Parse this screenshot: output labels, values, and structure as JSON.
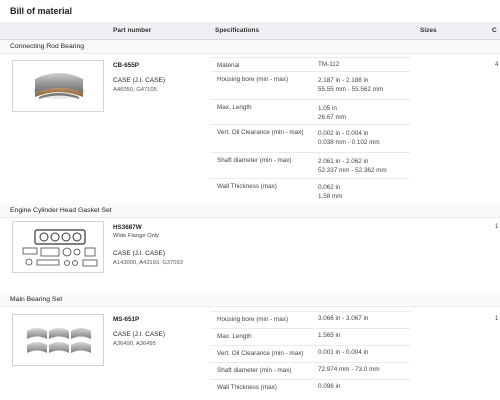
{
  "page_title": "Bill of material",
  "header": {
    "part_number": "Part number",
    "specifications": "Specifications",
    "sizes": "Sizes",
    "c": "C"
  },
  "sections": [
    {
      "title": "Connecting Rod Bearing",
      "part_number": "CB-655P",
      "subtitle": "",
      "brand": "CASE (J.I. CASE)",
      "xref": "A46050, G47105",
      "edge": "4",
      "specs": [
        {
          "label": "Material",
          "value1": "TM-112",
          "value2": ""
        },
        {
          "label": "Housing bore (min - max)",
          "value1": "2.187 in - 2.188 in",
          "value2": "55.55 mm - 55.562 mm"
        },
        {
          "label": "Max. Length",
          "value1": "1.05 in",
          "value2": "26.67 mm"
        },
        {
          "label": "Vert. Oil Clearance (min - max)",
          "value1": "0.002 in - 0.004 in",
          "value2": "0.038 mm - 0.102 mm"
        },
        {
          "label": "Shaft diameter (min - max)",
          "value1": "2.061 in - 2.062 in",
          "value2": "52.337 mm - 52.362 mm"
        },
        {
          "label": "Wall Thickness (max)",
          "value1": "0.062 in",
          "value2": "1.58 mm"
        }
      ]
    },
    {
      "title": "Engine Cylinder Head Gasket Set",
      "part_number": "HS3687W",
      "subtitle": "Wide Flange Only",
      "brand": "CASE (J.I. CASE)",
      "xref": "A143000, A43193, G37093",
      "edge": "1",
      "specs": []
    },
    {
      "title": "Main Bearing Set",
      "part_number": "MS-651P",
      "subtitle": "",
      "brand": "CASE (J.I. CASE)",
      "xref": "A36490, A36495",
      "edge": "1",
      "specs": [
        {
          "label": "Housing bore (min - max)",
          "value1": "3.066 in - 3.067 in",
          "value2": ""
        },
        {
          "label": "Max. Length",
          "value1": "1.565 in",
          "value2": ""
        },
        {
          "label": "Vert. Oil Clearance (min - max)",
          "value1": "0.001 in - 0.004 in",
          "value2": ""
        },
        {
          "label": "Shaft diameter (min - max)",
          "value1": "72.974 mm - 73.0 mm",
          "value2": ""
        },
        {
          "label": "Wall Thickness (max)",
          "value1": "0.096 in",
          "value2": ""
        }
      ]
    }
  ]
}
